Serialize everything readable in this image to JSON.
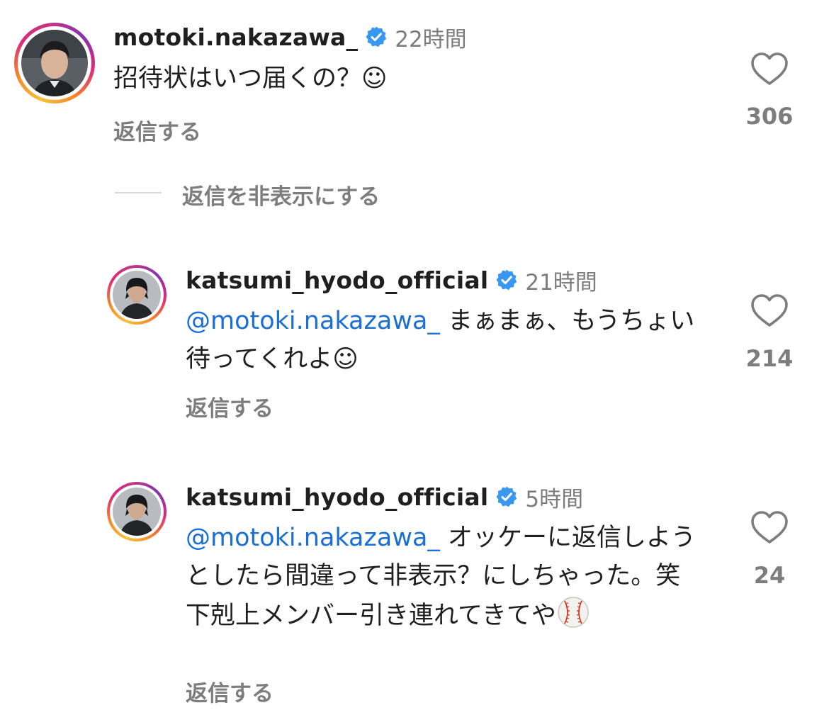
{
  "comments": [
    {
      "username": "motoki.nakazawa_",
      "time": "22時間",
      "text": "招待状はいつ届くの？☺",
      "reply_label": "返信する",
      "likes": "306",
      "avatar_icon": "profile-photo"
    },
    {
      "username": "katsumi_hyodo_official",
      "time": "21時間",
      "mention": "@motoki.nakazawa_",
      "text": " まぁまぁ、もうちょい待ってくれよ☺",
      "reply_label": "返信する",
      "likes": "214",
      "avatar_icon": "profile-photo"
    },
    {
      "username": "katsumi_hyodo_official",
      "time": "5時間",
      "mention": "@motoki.nakazawa_",
      "text": " オッケーに返信しようとしたら間違って非表示？にしちゃった。笑下剋上メンバー引き連れてきてや",
      "reply_label": "返信する",
      "likes": "24",
      "avatar_icon": "profile-photo",
      "emoji_icon": "baseball-emoji"
    }
  ],
  "hide_replies_label": "返信を非表示にする",
  "colors": {
    "mention": "#1a6fd6",
    "verified": "#3897f0",
    "muted": "#7d7d7d"
  }
}
